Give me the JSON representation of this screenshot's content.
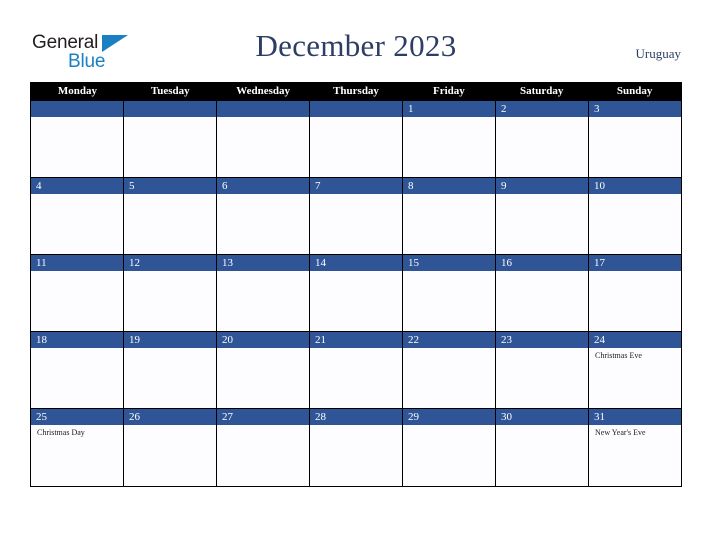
{
  "brand": {
    "logo_text_top": "General",
    "logo_text_bottom": "Blue",
    "logo_accent_color": "#1b7fc4",
    "logo_text_color": "#231f20"
  },
  "header": {
    "title": "December 2023",
    "country": "Uruguay",
    "title_color": "#2c3e63"
  },
  "theme": {
    "day_band_color": "#2f5597",
    "dow_header_bg": "#000000",
    "grid_line_color": "#000000",
    "cell_bg": "#fdfdff"
  },
  "calendar": {
    "month": "December",
    "year": "2023",
    "weekday_headers": [
      "Monday",
      "Tuesday",
      "Wednesday",
      "Thursday",
      "Friday",
      "Saturday",
      "Sunday"
    ],
    "weeks": [
      [
        {
          "day": "",
          "event": ""
        },
        {
          "day": "",
          "event": ""
        },
        {
          "day": "",
          "event": ""
        },
        {
          "day": "",
          "event": ""
        },
        {
          "day": "1",
          "event": ""
        },
        {
          "day": "2",
          "event": ""
        },
        {
          "day": "3",
          "event": ""
        }
      ],
      [
        {
          "day": "4",
          "event": ""
        },
        {
          "day": "5",
          "event": ""
        },
        {
          "day": "6",
          "event": ""
        },
        {
          "day": "7",
          "event": ""
        },
        {
          "day": "8",
          "event": ""
        },
        {
          "day": "9",
          "event": ""
        },
        {
          "day": "10",
          "event": ""
        }
      ],
      [
        {
          "day": "11",
          "event": ""
        },
        {
          "day": "12",
          "event": ""
        },
        {
          "day": "13",
          "event": ""
        },
        {
          "day": "14",
          "event": ""
        },
        {
          "day": "15",
          "event": ""
        },
        {
          "day": "16",
          "event": ""
        },
        {
          "day": "17",
          "event": ""
        }
      ],
      [
        {
          "day": "18",
          "event": ""
        },
        {
          "day": "19",
          "event": ""
        },
        {
          "day": "20",
          "event": ""
        },
        {
          "day": "21",
          "event": ""
        },
        {
          "day": "22",
          "event": ""
        },
        {
          "day": "23",
          "event": ""
        },
        {
          "day": "24",
          "event": "Christmas Eve"
        }
      ],
      [
        {
          "day": "25",
          "event": "Christmas Day"
        },
        {
          "day": "26",
          "event": ""
        },
        {
          "day": "27",
          "event": ""
        },
        {
          "day": "28",
          "event": ""
        },
        {
          "day": "29",
          "event": ""
        },
        {
          "day": "30",
          "event": ""
        },
        {
          "day": "31",
          "event": "New Year's Eve"
        }
      ]
    ]
  }
}
